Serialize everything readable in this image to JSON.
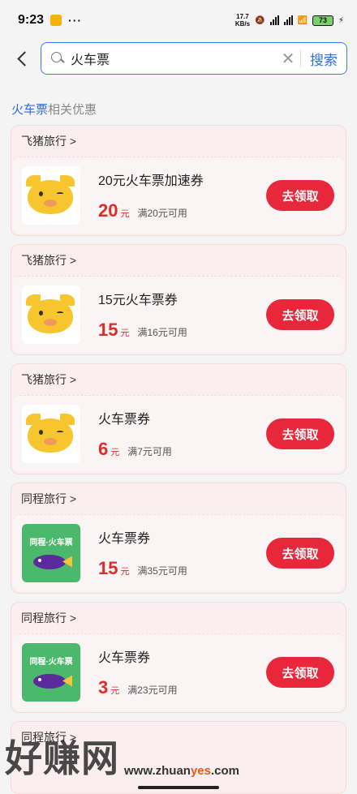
{
  "status_bar": {
    "time": "9:23",
    "net_speed": "17.7",
    "net_unit": "KB/s",
    "battery": "73"
  },
  "search": {
    "value": "火车票",
    "clear_icon": "close-icon",
    "button_label": "搜索"
  },
  "section": {
    "keyword": "火车票",
    "suffix": "相关优惠"
  },
  "cards": [
    {
      "vendor": "飞猪旅行 >",
      "logo": "fliggy-pig-logo",
      "title": "20元火车票加速券",
      "amount": "20",
      "unit": "元",
      "condition": "满20元可用",
      "button": "去领取"
    },
    {
      "vendor": "飞猪旅行 >",
      "logo": "fliggy-pig-logo",
      "title": "15元火车票券",
      "amount": "15",
      "unit": "元",
      "condition": "满16元可用",
      "button": "去领取"
    },
    {
      "vendor": "飞猪旅行 >",
      "logo": "fliggy-pig-logo",
      "title": "火车票券",
      "amount": "6",
      "unit": "元",
      "condition": "满7元可用",
      "button": "去领取"
    },
    {
      "vendor": "同程旅行 >",
      "logo": "tongcheng-logo",
      "logo_text": "同程·火车票",
      "title": "火车票券",
      "amount": "15",
      "unit": "元",
      "condition": "满35元可用",
      "button": "去领取"
    },
    {
      "vendor": "同程旅行 >",
      "logo": "tongcheng-logo",
      "logo_text": "同程·火车票",
      "title": "火车票券",
      "amount": "3",
      "unit": "元",
      "condition": "满23元可用",
      "button": "去领取"
    }
  ],
  "partial_card": {
    "vendor": "同程旅行 >"
  },
  "watermark": {
    "big": "好赚网",
    "small_a": "www.zhuan",
    "small_b": "yes",
    "small_c": ".com"
  },
  "colors": {
    "accent": "#2f6fe0",
    "price": "#e02b2b",
    "button": "#e8283a",
    "card_bg": "#fbeeee"
  }
}
